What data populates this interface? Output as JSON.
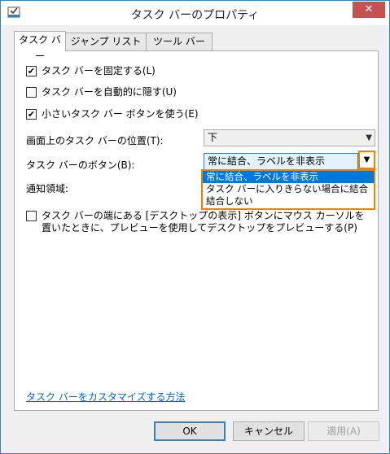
{
  "window": {
    "title": "タスク バーのプロパティ",
    "close": "✕"
  },
  "tabs": [
    {
      "label": "タスク バー"
    },
    {
      "label": "ジャンプ リスト"
    },
    {
      "label": "ツール バー"
    }
  ],
  "options": {
    "lock_taskbar": {
      "label": "タスク バーを固定する(L)",
      "checked": true
    },
    "autohide": {
      "label": "タスク バーを自動的に隠す(U)",
      "checked": false
    },
    "small_buttons": {
      "label": "小さいタスク バー ボタンを使う(E)",
      "checked": true
    }
  },
  "position": {
    "label": "画面上のタスク バーの位置(T):",
    "value": "下"
  },
  "buttons_combine": {
    "label": "タスク バーのボタン(B):",
    "value": "常に結合、ラベルを非表示",
    "options": [
      "常に結合、ラベルを非表示",
      "タスク バーに入りきらない場合に結合",
      "結合しない"
    ]
  },
  "notification": {
    "label": "通知領域:"
  },
  "peek": {
    "label": "タスク バーの端にある [デスクトップの表示] ボタンにマウス カーソルを置いたときに、プレビューを使用してデスクトップをプレビューする(P)",
    "checked": false
  },
  "help_link": "タスク バーをカスタマイズする方法",
  "footer": {
    "ok": "OK",
    "cancel": "キャンセル",
    "apply": "適用(A)"
  },
  "colors": {
    "highlight": "#f08000",
    "selection": "#0078d7",
    "link": "#0066cc"
  }
}
